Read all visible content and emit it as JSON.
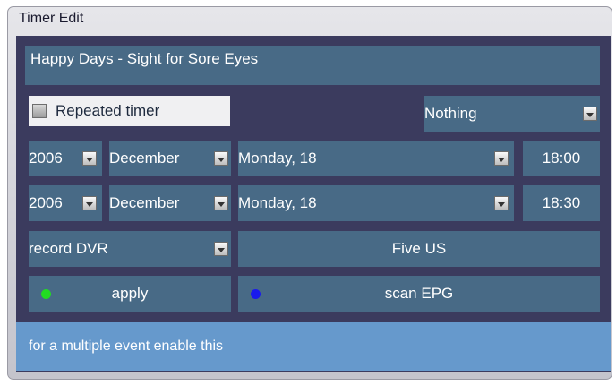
{
  "window": {
    "title": "Timer Edit"
  },
  "name_field": {
    "value": "Happy Days - Sight for Sore Eyes"
  },
  "repeated": {
    "label": "Repeated timer",
    "checked": false
  },
  "repeat_select": {
    "value": "Nothing"
  },
  "start": {
    "year": "2006",
    "month": "December",
    "day": "Monday, 18",
    "time": "18:00"
  },
  "end": {
    "year": "2006",
    "month": "December",
    "day": "Monday, 18",
    "time": "18:30"
  },
  "action_select": {
    "value": "record DVR"
  },
  "channel": {
    "value": "Five US"
  },
  "apply_button": {
    "label": "apply",
    "dot_color": "#22dd22"
  },
  "scan_button": {
    "label": "scan EPG",
    "dot_color": "#1a1aee"
  },
  "help": {
    "text": "for a multiple event enable this"
  },
  "colors": {
    "panel": "#3b3b5e",
    "field": "#486a86",
    "help_bar": "#6699cc"
  }
}
